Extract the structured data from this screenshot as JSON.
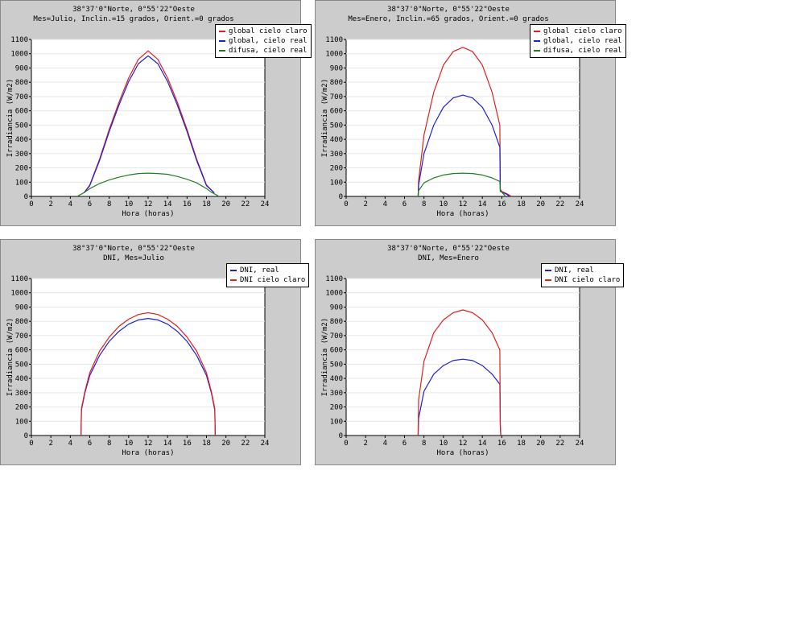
{
  "chart_data": [
    {
      "type": "line",
      "title": "38°37'0\"Norte, 0°55'22\"Oeste",
      "subtitle": "Mes=Julio, Inclin.=15 grados, Orient.=0 grados",
      "xlabel": "Hora (horas)",
      "ylabel": "Irradiancia (W/m2)",
      "xlim": [
        0,
        24
      ],
      "ylim": [
        0,
        1100
      ],
      "xticks": [
        0,
        2,
        4,
        6,
        8,
        10,
        12,
        14,
        16,
        18,
        20,
        22,
        24
      ],
      "yticks": [
        0,
        100,
        200,
        300,
        400,
        500,
        600,
        700,
        800,
        900,
        1000,
        1100
      ],
      "legend_position": "top-right",
      "series": [
        {
          "name": "global cielo claro",
          "color": "#e02020",
          "x": [
            5.4,
            6,
            7,
            8,
            9,
            10,
            11,
            12,
            13,
            14,
            15,
            16,
            17,
            18,
            18.8
          ],
          "y": [
            25,
            80,
            260,
            470,
            660,
            830,
            960,
            1020,
            960,
            830,
            660,
            470,
            260,
            80,
            25
          ]
        },
        {
          "name": "global, cielo real",
          "color": "#2020d0",
          "x": [
            5.4,
            6,
            7,
            8,
            9,
            10,
            11,
            12,
            13,
            14,
            15,
            16,
            17,
            18,
            18.8
          ],
          "y": [
            25,
            75,
            250,
            455,
            640,
            805,
            930,
            985,
            930,
            805,
            640,
            455,
            250,
            75,
            25
          ]
        },
        {
          "name": "difusa, cielo real",
          "color": "#208020",
          "x": [
            4.7,
            5.5,
            6,
            7,
            8,
            9,
            10,
            11,
            12,
            13,
            14,
            15,
            16,
            17,
            18,
            18.5,
            19.3
          ],
          "y": [
            0,
            30,
            55,
            90,
            115,
            135,
            150,
            160,
            163,
            160,
            155,
            140,
            120,
            95,
            55,
            30,
            0
          ]
        }
      ]
    },
    {
      "type": "line",
      "title": "38°37'0\"Norte, 0°55'22\"Oeste",
      "subtitle": "Mes=Enero, Inclin.=65 grados, Orient.=0 grados",
      "xlabel": "Hora (horas)",
      "ylabel": "Irradiancia (W/m2)",
      "xlim": [
        0,
        24
      ],
      "ylim": [
        0,
        1100
      ],
      "xticks": [
        0,
        2,
        4,
        6,
        8,
        10,
        12,
        14,
        16,
        18,
        20,
        22,
        24
      ],
      "yticks": [
        0,
        100,
        200,
        300,
        400,
        500,
        600,
        700,
        800,
        900,
        1000,
        1100
      ],
      "legend_position": "top-right",
      "series": [
        {
          "name": "global cielo claro",
          "color": "#e02020",
          "x": [
            7.4,
            7.45,
            8,
            9,
            10,
            11,
            12,
            13,
            14,
            15,
            15.8,
            15.85,
            16,
            16.5,
            17
          ],
          "y": [
            0,
            110,
            430,
            730,
            920,
            1015,
            1045,
            1015,
            920,
            730,
            500,
            50,
            35,
            20,
            0
          ]
        },
        {
          "name": "global, cielo real",
          "color": "#2020d0",
          "x": [
            7.4,
            7.45,
            8,
            9,
            10,
            11,
            12,
            13,
            14,
            15,
            15.8,
            15.85,
            16,
            16.5,
            16.8
          ],
          "y": [
            0,
            80,
            300,
            500,
            625,
            690,
            710,
            690,
            625,
            500,
            345,
            40,
            30,
            15,
            0
          ]
        },
        {
          "name": "difusa, cielo real",
          "color": "#208020",
          "x": [
            7.4,
            7.45,
            8,
            9,
            10,
            11,
            12,
            13,
            14,
            15,
            15.8,
            15.85,
            16,
            16.4
          ],
          "y": [
            0,
            40,
            95,
            130,
            150,
            160,
            163,
            160,
            150,
            130,
            105,
            35,
            30,
            0
          ]
        }
      ]
    },
    {
      "type": "line",
      "title": "38°37'0\"Norte, 0°55'22\"Oeste",
      "subtitle": "DNI, Mes=Julio",
      "xlabel": "Hora (horas)",
      "ylabel": "Irradiancia (W/m2)",
      "xlim": [
        0,
        24
      ],
      "ylim": [
        0,
        1100
      ],
      "xticks": [
        0,
        2,
        4,
        6,
        8,
        10,
        12,
        14,
        16,
        18,
        20,
        22,
        24
      ],
      "yticks": [
        0,
        100,
        200,
        300,
        400,
        500,
        600,
        700,
        800,
        900,
        1000,
        1100
      ],
      "legend_position": "top-right",
      "series": [
        {
          "name": "DNI, real",
          "color": "#2020d0",
          "x": [
            5.1,
            5.15,
            5.5,
            6,
            7,
            8,
            9,
            10,
            11,
            12,
            13,
            14,
            15,
            16,
            17,
            18,
            18.5,
            18.85,
            18.9
          ],
          "y": [
            0,
            180,
            300,
            420,
            560,
            660,
            730,
            780,
            810,
            820,
            810,
            780,
            730,
            660,
            560,
            420,
            300,
            180,
            0
          ]
        },
        {
          "name": "DNI cielo claro",
          "color": "#e02020",
          "x": [
            5.1,
            5.15,
            5.5,
            6,
            7,
            8,
            9,
            10,
            11,
            12,
            13,
            14,
            15,
            16,
            17,
            18,
            18.5,
            18.85,
            18.9
          ],
          "y": [
            0,
            190,
            310,
            440,
            590,
            690,
            765,
            815,
            848,
            860,
            848,
            815,
            765,
            690,
            590,
            440,
            310,
            190,
            0
          ]
        }
      ]
    },
    {
      "type": "line",
      "title": "38°37'0\"Norte, 0°55'22\"Oeste",
      "subtitle": "DNI, Mes=Enero",
      "xlabel": "Hora (horas)",
      "ylabel": "Irradiancia (W/m2)",
      "xlim": [
        0,
        24
      ],
      "ylim": [
        0,
        1100
      ],
      "xticks": [
        0,
        2,
        4,
        6,
        8,
        10,
        12,
        14,
        16,
        18,
        20,
        22,
        24
      ],
      "yticks": [
        0,
        100,
        200,
        300,
        400,
        500,
        600,
        700,
        800,
        900,
        1000,
        1100
      ],
      "legend_position": "top-right",
      "series": [
        {
          "name": "DNI, real",
          "color": "#2020d0",
          "x": [
            7.4,
            7.45,
            8,
            9,
            10,
            11,
            12,
            13,
            14,
            15,
            15.8,
            15.85,
            15.9
          ],
          "y": [
            0,
            120,
            310,
            430,
            490,
            525,
            535,
            525,
            490,
            430,
            360,
            60,
            0
          ]
        },
        {
          "name": "DNI cielo claro",
          "color": "#e02020",
          "x": [
            7.4,
            7.45,
            8,
            9,
            10,
            11,
            12,
            13,
            14,
            15,
            15.8,
            15.85,
            15.9
          ],
          "y": [
            0,
            250,
            520,
            720,
            810,
            860,
            880,
            860,
            810,
            720,
            600,
            80,
            0
          ]
        }
      ]
    }
  ]
}
